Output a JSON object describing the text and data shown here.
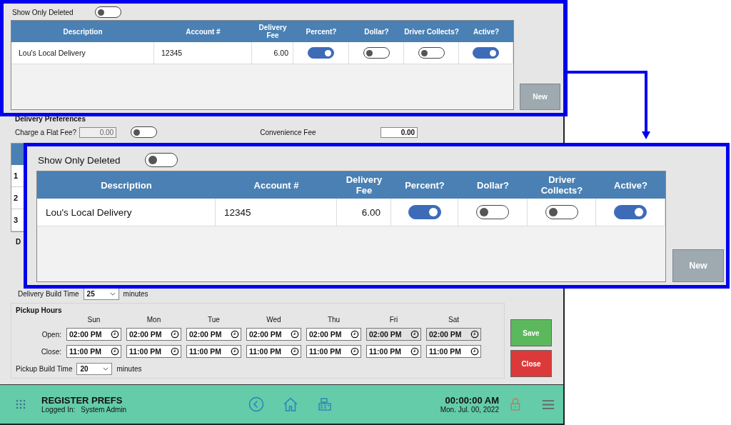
{
  "deliveries_panel": {
    "show_only_deleted": {
      "label": "Show Only Deleted",
      "on": false
    },
    "columns": [
      {
        "label": "Description",
        "kind": "text"
      },
      {
        "label": "Account #",
        "kind": "text"
      },
      {
        "label": "Delivery Fee",
        "kind": "number"
      },
      {
        "label": "Percent?",
        "kind": "toggle"
      },
      {
        "label": "Dollar?",
        "kind": "toggle"
      },
      {
        "label": "Driver Collects?",
        "kind": "toggle"
      },
      {
        "label": "Active?",
        "kind": "toggle"
      }
    ],
    "rows": [
      {
        "cells": [
          {
            "text": "Lou's Local Delivery"
          },
          {
            "text": "12345"
          },
          {
            "text": "6.00"
          },
          {
            "on": true
          },
          {
            "on": false
          },
          {
            "on": false
          },
          {
            "on": true
          }
        ]
      }
    ],
    "new_button": "New"
  },
  "zoomed_panel": {
    "show_only_deleted": {
      "label": "Show Only Deleted",
      "on": false
    },
    "columns": [
      {
        "label": "Description",
        "kind": "text"
      },
      {
        "label": "Account #",
        "kind": "text"
      },
      {
        "label": "Delivery Fee",
        "kind": "number"
      },
      {
        "label": "Percent?",
        "kind": "toggle"
      },
      {
        "label": "Dollar?",
        "kind": "toggle"
      },
      {
        "label": "Driver Collects?",
        "kind": "toggle"
      },
      {
        "label": "Active?",
        "kind": "toggle"
      }
    ],
    "rows": [
      {
        "cells": [
          {
            "text": "Lou's Local Delivery"
          },
          {
            "text": "12345"
          },
          {
            "text": "6.00"
          },
          {
            "on": true
          },
          {
            "on": false
          },
          {
            "on": false
          },
          {
            "on": true
          }
        ]
      }
    ],
    "new_button": "New"
  },
  "delivery_preferences": {
    "title": "Delivery Preferences",
    "charge_flat_fee": {
      "label": "Charge a Flat Fee?",
      "value": "0.00",
      "on": false
    },
    "convenience_fee": {
      "label": "Convenience Fee",
      "value": "0.00"
    },
    "fee_rows": [
      "1",
      "2",
      "3"
    ],
    "cut_label": "D",
    "build_time": {
      "label": "Delivery Build Time",
      "value": "25",
      "unit": "minutes"
    }
  },
  "pickup_hours": {
    "title": "Pickup Hours",
    "days": [
      "Sun",
      "Mon",
      "Tue",
      "Wed",
      "Thu",
      "Fri",
      "Sat"
    ],
    "open_label": "Open:",
    "close_label": "Close:",
    "open": [
      {
        "value": "02:00 PM",
        "disabled": false
      },
      {
        "value": "02:00 PM",
        "disabled": false
      },
      {
        "value": "02:00 PM",
        "disabled": false
      },
      {
        "value": "02:00 PM",
        "disabled": false
      },
      {
        "value": "02:00 PM",
        "disabled": false
      },
      {
        "value": "02:00 PM",
        "disabled": true
      },
      {
        "value": "02:00 PM",
        "disabled": true
      }
    ],
    "close": [
      {
        "value": "11:00 PM",
        "disabled": false
      },
      {
        "value": "11:00 PM",
        "disabled": false
      },
      {
        "value": "11:00 PM",
        "disabled": false
      },
      {
        "value": "11:00 PM",
        "disabled": false
      },
      {
        "value": "11:00 PM",
        "disabled": false
      },
      {
        "value": "11:00 PM",
        "disabled": false
      },
      {
        "value": "11:00 PM",
        "disabled": false
      }
    ],
    "build_time": {
      "label": "Pickup Build Time",
      "value": "20",
      "unit": "minutes"
    }
  },
  "buttons": {
    "save": "Save",
    "close": "Close"
  },
  "status_bar": {
    "title": "REGISTER PREFS",
    "logged_in_label": "Logged In:",
    "user": "System Admin",
    "time": "00:00:00 AM",
    "date": "Mon. Jul. 00, 2022"
  }
}
